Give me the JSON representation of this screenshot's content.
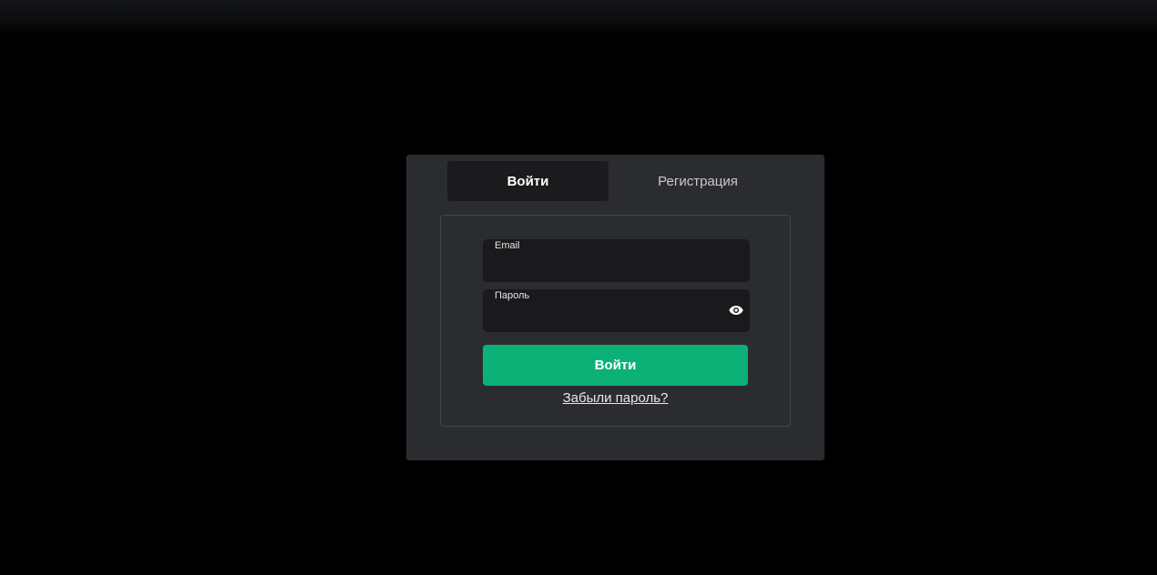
{
  "tabs": {
    "login_label": "Войти",
    "register_label": "Регистрация",
    "active": "login"
  },
  "form": {
    "email_label": "Email",
    "email_value": "",
    "password_label": "Пароль",
    "password_value": "",
    "password_toggle_icon": "eye-icon",
    "submit_label": "Войти",
    "forgot_password_label": "Забыли пароль?"
  },
  "colors": {
    "page_background": "#000000",
    "card_background": "#2b2c30",
    "input_background": "#1a1a1c",
    "accent_green": "#0bb176",
    "active_tab_background": "#1b1b1d"
  }
}
